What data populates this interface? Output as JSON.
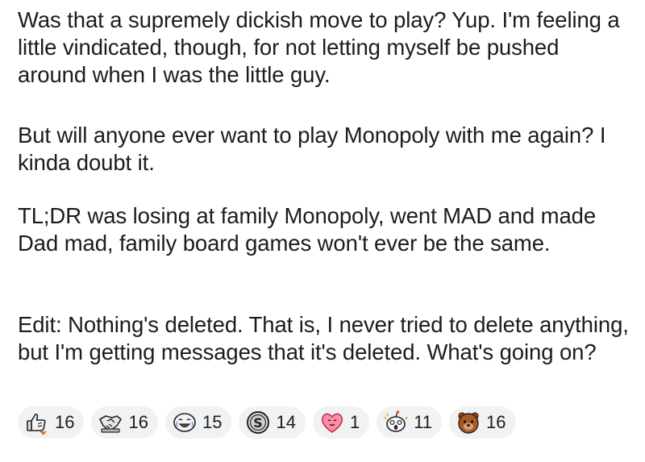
{
  "post": {
    "paragraphs": [
      "Was that a supremely dickish move to play? Yup. I'm feeling a little vindicated, though, for not letting myself be pushed around when I was the little guy.",
      "But will anyone ever want to play Monopoly with me again? I kinda doubt it.",
      "TL;DR was losing at family Monopoly, went MAD and made Dad mad, family board games won't ever be the same.",
      "Edit: Nothing's deleted.  That is, I never tried to delete anything, but I'm getting messages that it's deleted. What's going on?"
    ]
  },
  "awards": [
    {
      "icon": "thumbs-up-rocket-icon",
      "count": "16"
    },
    {
      "icon": "handshake-icon",
      "count": "16"
    },
    {
      "icon": "crying-laughing-face-icon",
      "count": "15"
    },
    {
      "icon": "silver-coin-icon",
      "count": "14"
    },
    {
      "icon": "heart-face-icon",
      "count": "1"
    },
    {
      "icon": "shocked-snoo-icon",
      "count": "11"
    },
    {
      "icon": "bear-icon",
      "count": "16"
    }
  ]
}
